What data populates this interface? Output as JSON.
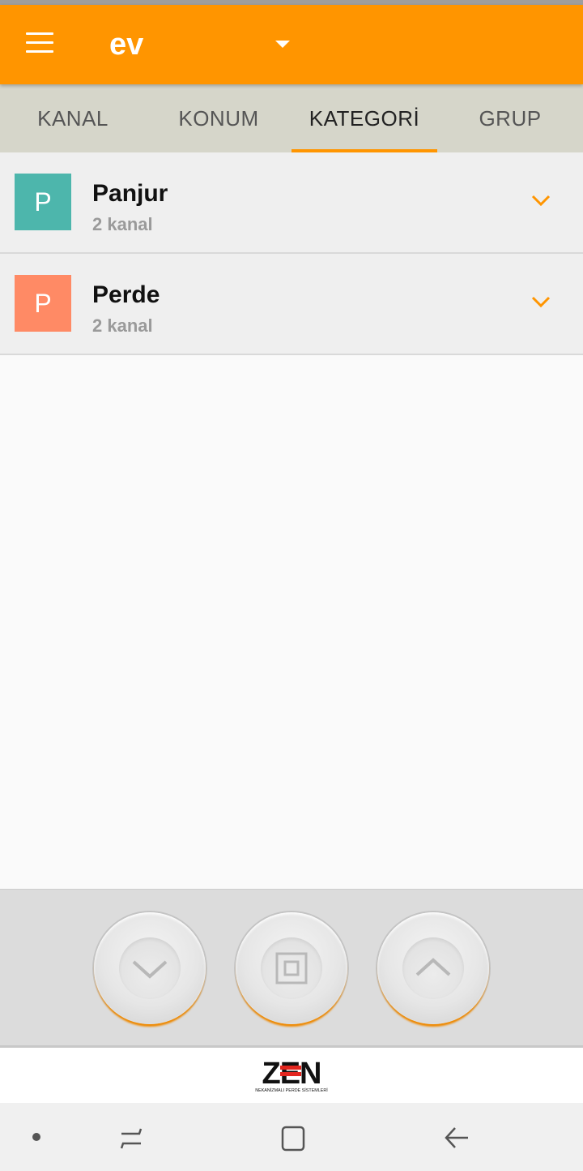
{
  "app": {
    "title": "ev",
    "accent": "#ff9500"
  },
  "icons": {
    "menu": "hamburger-menu-icon",
    "dropdown": "triangle-down-icon",
    "expand": "chevron-down-icon",
    "control_down": "chevron-down-icon",
    "control_stop": "square-stop-icon",
    "control_up": "chevron-up-icon",
    "nav_dot": "dot-icon",
    "nav_recent": "recent-apps-icon",
    "nav_home": "home-square-icon",
    "nav_back": "back-arrow-icon"
  },
  "tabs": [
    {
      "label": "KANAL",
      "active": false
    },
    {
      "label": "KONUM",
      "active": false
    },
    {
      "label": "KATEGORİ",
      "active": true
    },
    {
      "label": "GRUP",
      "active": false
    }
  ],
  "categories": [
    {
      "initial": "P",
      "title": "Panjur",
      "subtitle": "2 kanal",
      "color": "#4db6ac"
    },
    {
      "initial": "P",
      "title": "Perde",
      "subtitle": "2 kanal",
      "color": "#ff8a65"
    }
  ],
  "brand": {
    "logo_text": "ZEN",
    "tagline": "NEKANİZMALI PERDE SİSTEMLERİ"
  }
}
